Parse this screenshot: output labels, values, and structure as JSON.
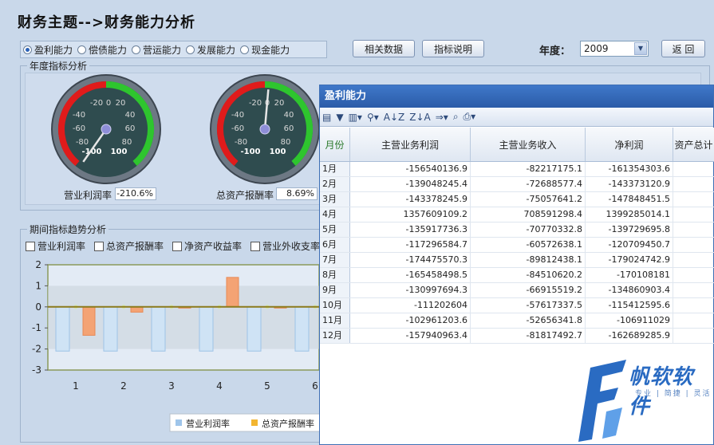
{
  "title": "财务主题-->财务能力分析",
  "radios": [
    {
      "label": "盈利能力",
      "selected": true
    },
    {
      "label": "偿债能力",
      "selected": false
    },
    {
      "label": "营运能力",
      "selected": false
    },
    {
      "label": "发展能力",
      "selected": false
    },
    {
      "label": "现金能力",
      "selected": false
    }
  ],
  "buttons": {
    "related": "相关数据",
    "explain": "指标说明",
    "back": "返 回"
  },
  "year": {
    "label": "年度：",
    "value": "2009"
  },
  "annual_section": {
    "legend": "年度指标分析"
  },
  "gauges": [
    {
      "caption": "营业利润率",
      "value_text": "-210.6%",
      "ticks": [
        "-20",
        "0",
        "20",
        "-40",
        "40",
        "-60",
        "60",
        "-80",
        "80",
        "-100",
        "100"
      ]
    },
    {
      "caption": "总资产报酬率",
      "value_text": "8.69%",
      "ticks": [
        "-20",
        "0",
        "20",
        "-40",
        "40",
        "-60",
        "60",
        "-80",
        "80",
        "-100",
        "100"
      ]
    }
  ],
  "trend_section": {
    "legend": "期间指标趋势分析",
    "checkboxes": [
      "营业利润率",
      "总资产报酬率",
      "净资产收益率",
      "营业外收支率"
    ]
  },
  "chart_data": {
    "type": "bar",
    "categories": [
      "1",
      "2",
      "3",
      "4",
      "5",
      "6"
    ],
    "ylim": [
      -3,
      2
    ],
    "yticks": [
      "2",
      "1",
      "0",
      "-1",
      "-2",
      "-3"
    ],
    "series": [
      {
        "name": "营业利润率",
        "color": "#bcd9f3",
        "values": [
          -2.1,
          -2.1,
          -2.1,
          -2.1,
          -2.1,
          -2.1
        ]
      },
      {
        "name": "总资产报酬率",
        "color": "#f4a374",
        "values": [
          -1.35,
          -0.25,
          -0.05,
          1.4,
          -0.05,
          null
        ]
      }
    ],
    "legend": [
      "营业利润率",
      "总资产报酬率"
    ]
  },
  "popup": {
    "title": "盈利能力",
    "toolbar": [
      "▤",
      "▼",
      "▥▾",
      "⚲▾",
      "A↓Z",
      "Z↓A",
      "⇒▾",
      "⌕",
      "⎙▾"
    ],
    "columns": [
      "月份",
      "主营业务利润",
      "主营业务收入",
      "净利润",
      "资产总计"
    ],
    "rows": [
      [
        "1月",
        "-156540136.9",
        "-82217175.1",
        "-161354303.6",
        ""
      ],
      [
        "2月",
        "-139048245.4",
        "-72688577.4",
        "-143373120.9",
        ""
      ],
      [
        "3月",
        "-143378245.9",
        "-75057641.2",
        "-147848451.5",
        ""
      ],
      [
        "4月",
        "1357609109.2",
        "708591298.4",
        "1399285014.1",
        ""
      ],
      [
        "5月",
        "-135917736.3",
        "-70770332.8",
        "-139729695.8",
        ""
      ],
      [
        "6月",
        "-117296584.7",
        "-60572638.1",
        "-120709450.7",
        ""
      ],
      [
        "7月",
        "-174475570.3",
        "-89812438.1",
        "-179024742.9",
        ""
      ],
      [
        "8月",
        "-165458498.5",
        "-84510620.2",
        "-170108181",
        ""
      ],
      [
        "9月",
        "-130997694.3",
        "-66915519.2",
        "-134860903.4",
        ""
      ],
      [
        "10月",
        "-111202604",
        "-57617337.5",
        "-115412595.6",
        ""
      ],
      [
        "11月",
        "-102961203.6",
        "-52656341.8",
        "-106911029",
        ""
      ],
      [
        "12月",
        "-157940963.4",
        "-81817492.7",
        "-162689285.9",
        ""
      ]
    ]
  },
  "logo": {
    "text": "帆软软件",
    "sub": "专业 | 简捷 | 灵活"
  }
}
